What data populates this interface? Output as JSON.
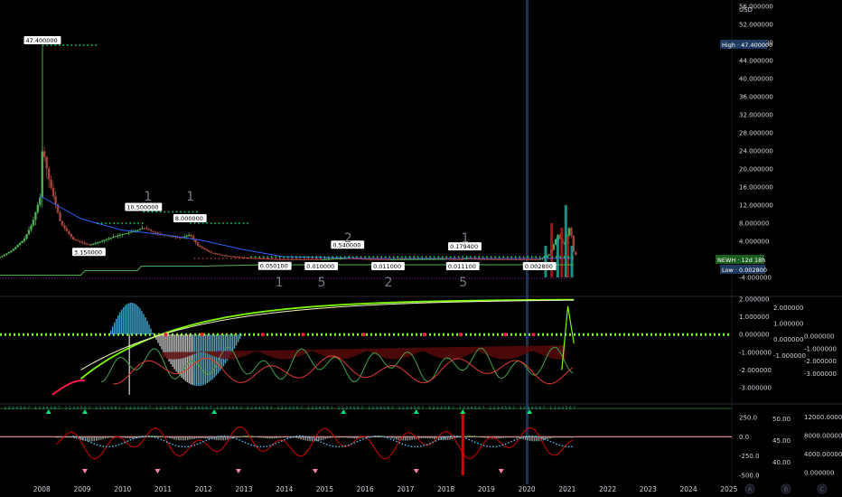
{
  "currency": "USD",
  "main_axis": {
    "labels": [
      "56.000000",
      "52.000000",
      "48.000000",
      "44.000000",
      "40.000000",
      "36.000000",
      "32.000000",
      "28.000000",
      "24.000000",
      "20.000000",
      "16.000000",
      "12.000000",
      "8.000000",
      "4.000000",
      "-4.000000"
    ],
    "values": [
      56,
      52,
      48,
      44,
      40,
      36,
      32,
      28,
      24,
      20,
      16,
      12,
      8,
      4,
      -4
    ]
  },
  "badges": {
    "high": "High · 47.400000",
    "newh": "NEWH · 12d 18h",
    "low": "Low · 0.002800"
  },
  "pivot_labels": [
    {
      "text": "47.400000",
      "year": 2008.05,
      "value": 47.4,
      "kind": "high"
    },
    {
      "text": "10.500000",
      "year": 2010.55,
      "value": 10.5,
      "kind": "high"
    },
    {
      "text": "8.000000",
      "year": 2011.7,
      "value": 8.0,
      "kind": "high"
    },
    {
      "text": "0.540000",
      "year": 2015.6,
      "value": 0.54,
      "kind": "high"
    },
    {
      "text": "0.179400",
      "year": 2018.5,
      "value": 0.1794,
      "kind": "high"
    },
    {
      "text": "3.150000",
      "year": 2009.2,
      "value": 3.15,
      "kind": "low"
    },
    {
      "text": "0.050100",
      "year": 2013.8,
      "value": 0.0501,
      "kind": "low"
    },
    {
      "text": "0.010000",
      "year": 2014.95,
      "value": 0.01,
      "kind": "low"
    },
    {
      "text": "0.011000",
      "year": 2016.6,
      "value": 0.011,
      "kind": "low"
    },
    {
      "text": "0.011100",
      "year": 2018.45,
      "value": 0.0111,
      "kind": "low"
    },
    {
      "text": "0.002800",
      "year": 2020.35,
      "value": 0.0028,
      "kind": "low"
    }
  ],
  "wave_counts": [
    {
      "text": "1",
      "year": 2010.65,
      "pos": "top"
    },
    {
      "text": "1",
      "year": 2011.7,
      "pos": "top"
    },
    {
      "text": "2",
      "year": 2015.6,
      "pos": "top"
    },
    {
      "text": "1",
      "year": 2018.5,
      "pos": "top"
    },
    {
      "text": "1",
      "year": 2013.9,
      "pos": "bottom"
    },
    {
      "text": "5",
      "year": 2014.95,
      "pos": "bottom"
    },
    {
      "text": "2",
      "year": 2016.6,
      "pos": "bottom"
    },
    {
      "text": "5",
      "year": 2018.45,
      "pos": "bottom"
    }
  ],
  "osc1_axis_left": {
    "labels": [
      "2.000000",
      "1.000000",
      "0.000000",
      "-1.000000",
      "-2.000000",
      "-3.000000"
    ],
    "values": [
      2,
      1,
      0,
      -1,
      -2,
      -3
    ]
  },
  "osc1_axis_right": {
    "labels": [
      "0.000000",
      "-1.000000",
      "-2.000000",
      "-3.000000"
    ],
    "values": [
      0,
      -1,
      -2,
      -3
    ]
  },
  "osc1_axis_mid": {
    "labels": [
      "2.000000",
      "1.000000",
      "0.000000",
      "-1.000000"
    ],
    "values": [
      2,
      1,
      0,
      -1
    ]
  },
  "osc2_axis_a": {
    "labels": [
      "250.0",
      "0.0",
      "-250.0",
      "-500.0"
    ],
    "values": [
      250,
      0,
      -250,
      -500
    ]
  },
  "osc2_axis_b": {
    "labels": [
      "50.00",
      "45.00",
      "40.00"
    ],
    "values": [
      50,
      45,
      40
    ]
  },
  "osc2_axis_c": {
    "labels": [
      "12000.000000",
      "8000.000000",
      "4000.000000",
      "0.000000"
    ],
    "values": [
      12000,
      8000,
      4000,
      0
    ]
  },
  "x_axis": {
    "years": [
      "2008",
      "2009",
      "2010",
      "2011",
      "2012",
      "2013",
      "2014",
      "2015",
      "2016",
      "2017",
      "2018",
      "2019",
      "2020",
      "2021",
      "2022",
      "2023",
      "2024",
      "2025"
    ],
    "values": [
      2008,
      2009,
      2010,
      2011,
      2012,
      2013,
      2014,
      2015,
      2016,
      2017,
      2018,
      2019,
      2020,
      2021,
      2022,
      2023,
      2024,
      2025
    ]
  },
  "footer_icons": [
    {
      "name": "auto-icon",
      "glyph": "A"
    },
    {
      "name": "log-icon",
      "glyph": "B"
    },
    {
      "name": "settings-icon",
      "glyph": "C"
    }
  ],
  "colors": {
    "up": "#26a69a",
    "down": "#ef5350",
    "green": "#4caf50",
    "bright": "#00e676",
    "blue": "#2962ff",
    "navy": "#1e2a78",
    "highlight": "#1e3a5f",
    "pink": "#e91e63"
  },
  "chart_data": {
    "type": "candlestick",
    "ylim": [
      -4,
      56
    ],
    "xlim": [
      2007.0,
      2026.0
    ],
    "price_series": {
      "x": [
        2007.0,
        2007.3,
        2007.6,
        2007.8,
        2008.0,
        2008.05,
        2008.2,
        2008.5,
        2008.8,
        2009.0,
        2009.2,
        2009.5,
        2009.8,
        2010.0,
        2010.3,
        2010.55,
        2010.8,
        2011.0,
        2011.3,
        2011.5,
        2011.7,
        2011.9,
        2012.2,
        2012.5,
        2013.0,
        2013.5,
        2013.8,
        2014.5,
        2014.95,
        2015.6,
        2016.0,
        2016.6,
        2017.0,
        2018.0,
        2018.45,
        2018.5,
        2019.0,
        2019.5,
        2020.0,
        2020.35,
        2020.6,
        2020.8,
        2020.95,
        2021.1,
        2021.2
      ],
      "close": [
        0.5,
        2.0,
        4.5,
        8.0,
        14.0,
        25.0,
        18.0,
        8.0,
        4.5,
        3.8,
        3.15,
        4.0,
        5.0,
        5.5,
        6.2,
        7.0,
        6.0,
        5.5,
        5.0,
        4.8,
        5.5,
        3.0,
        1.5,
        0.9,
        0.4,
        0.2,
        0.05,
        0.03,
        0.01,
        0.3,
        0.1,
        0.011,
        0.05,
        0.1,
        0.011,
        0.1794,
        0.05,
        0.03,
        0.02,
        0.0028,
        1.2,
        5.5,
        3.0,
        7.5,
        1.0
      ]
    },
    "moving_averages": [
      {
        "name": "",
        "color": "#2962ff",
        "x": [
          2008.0,
          2009.0,
          2010.0,
          2011.0,
          2012.0,
          2013.0,
          2014.0,
          2016.0,
          2021.2
        ],
        "y": [
          14.0,
          9.0,
          6.5,
          5.5,
          4.2,
          2.2,
          0.6,
          0.2,
          0.2
        ]
      },
      {
        "name": "",
        "color": "#4caf50",
        "x": [
          2007.0,
          2009.0,
          2009.1,
          2010.4,
          2010.5,
          2012.0,
          2013.5,
          2021.2
        ],
        "y": [
          -3.5,
          -3.5,
          -2.5,
          -2.5,
          -1.5,
          -1.5,
          -1.2,
          -1.2
        ]
      }
    ],
    "resistance_lines": [
      {
        "from": 2008.05,
        "to": 2009.4,
        "value": 47.4
      },
      {
        "from": 2009.4,
        "to": 2010.55,
        "value": 8.0
      },
      {
        "from": 2010.55,
        "to": 2011.95,
        "value": 10.5
      },
      {
        "from": 2011.7,
        "to": 2013.2,
        "value": 8.0
      },
      {
        "from": 2013.2,
        "to": 2021.2,
        "value": 0.54
      }
    ],
    "volume_spikes": {
      "x": [
        2020.5,
        2020.65,
        2020.8,
        2020.9,
        2021.0,
        2021.05,
        2021.15
      ],
      "y": [
        3,
        8,
        5,
        7,
        12,
        5,
        3
      ]
    }
  }
}
